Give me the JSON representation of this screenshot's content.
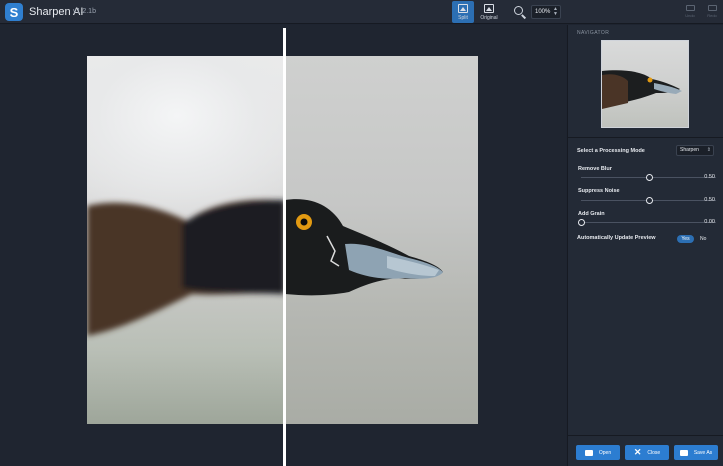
{
  "app": {
    "name": "Sharpen AI",
    "version": "v1.2.1b"
  },
  "toolbar": {
    "split_label": "Split",
    "original_label": "Original",
    "zoom_value": "100%",
    "undo_label": "Undo",
    "redo_label": "Redo"
  },
  "navigator": {
    "title": "NAVIGATOR"
  },
  "processing": {
    "mode_label": "Select a Processing Mode",
    "mode_value": "Sharpen"
  },
  "sliders": [
    {
      "label": "Remove Blur",
      "value": "0.50",
      "level": 0.5
    },
    {
      "label": "Suppress Noise",
      "value": "0.50",
      "level": 0.5
    },
    {
      "label": "Add Grain",
      "value": "0.00",
      "level": 0.0
    }
  ],
  "auto_update": {
    "label": "Automatically Update Preview",
    "yes": "Yes",
    "no": "No"
  },
  "buttons": {
    "open": "Open",
    "close": "Close",
    "save_as": "Save As"
  },
  "icons": {
    "logo": "sharpen-logo-icon",
    "split": "split-view-icon",
    "original": "original-view-icon",
    "zoom": "zoom-icon",
    "undo": "undo-icon",
    "redo": "redo-icon",
    "open": "folder-icon",
    "close": "close-x-icon",
    "save": "save-icon"
  },
  "colors": {
    "accent": "#2c7dd1",
    "background": "#1e2430",
    "panel": "#232a36"
  }
}
